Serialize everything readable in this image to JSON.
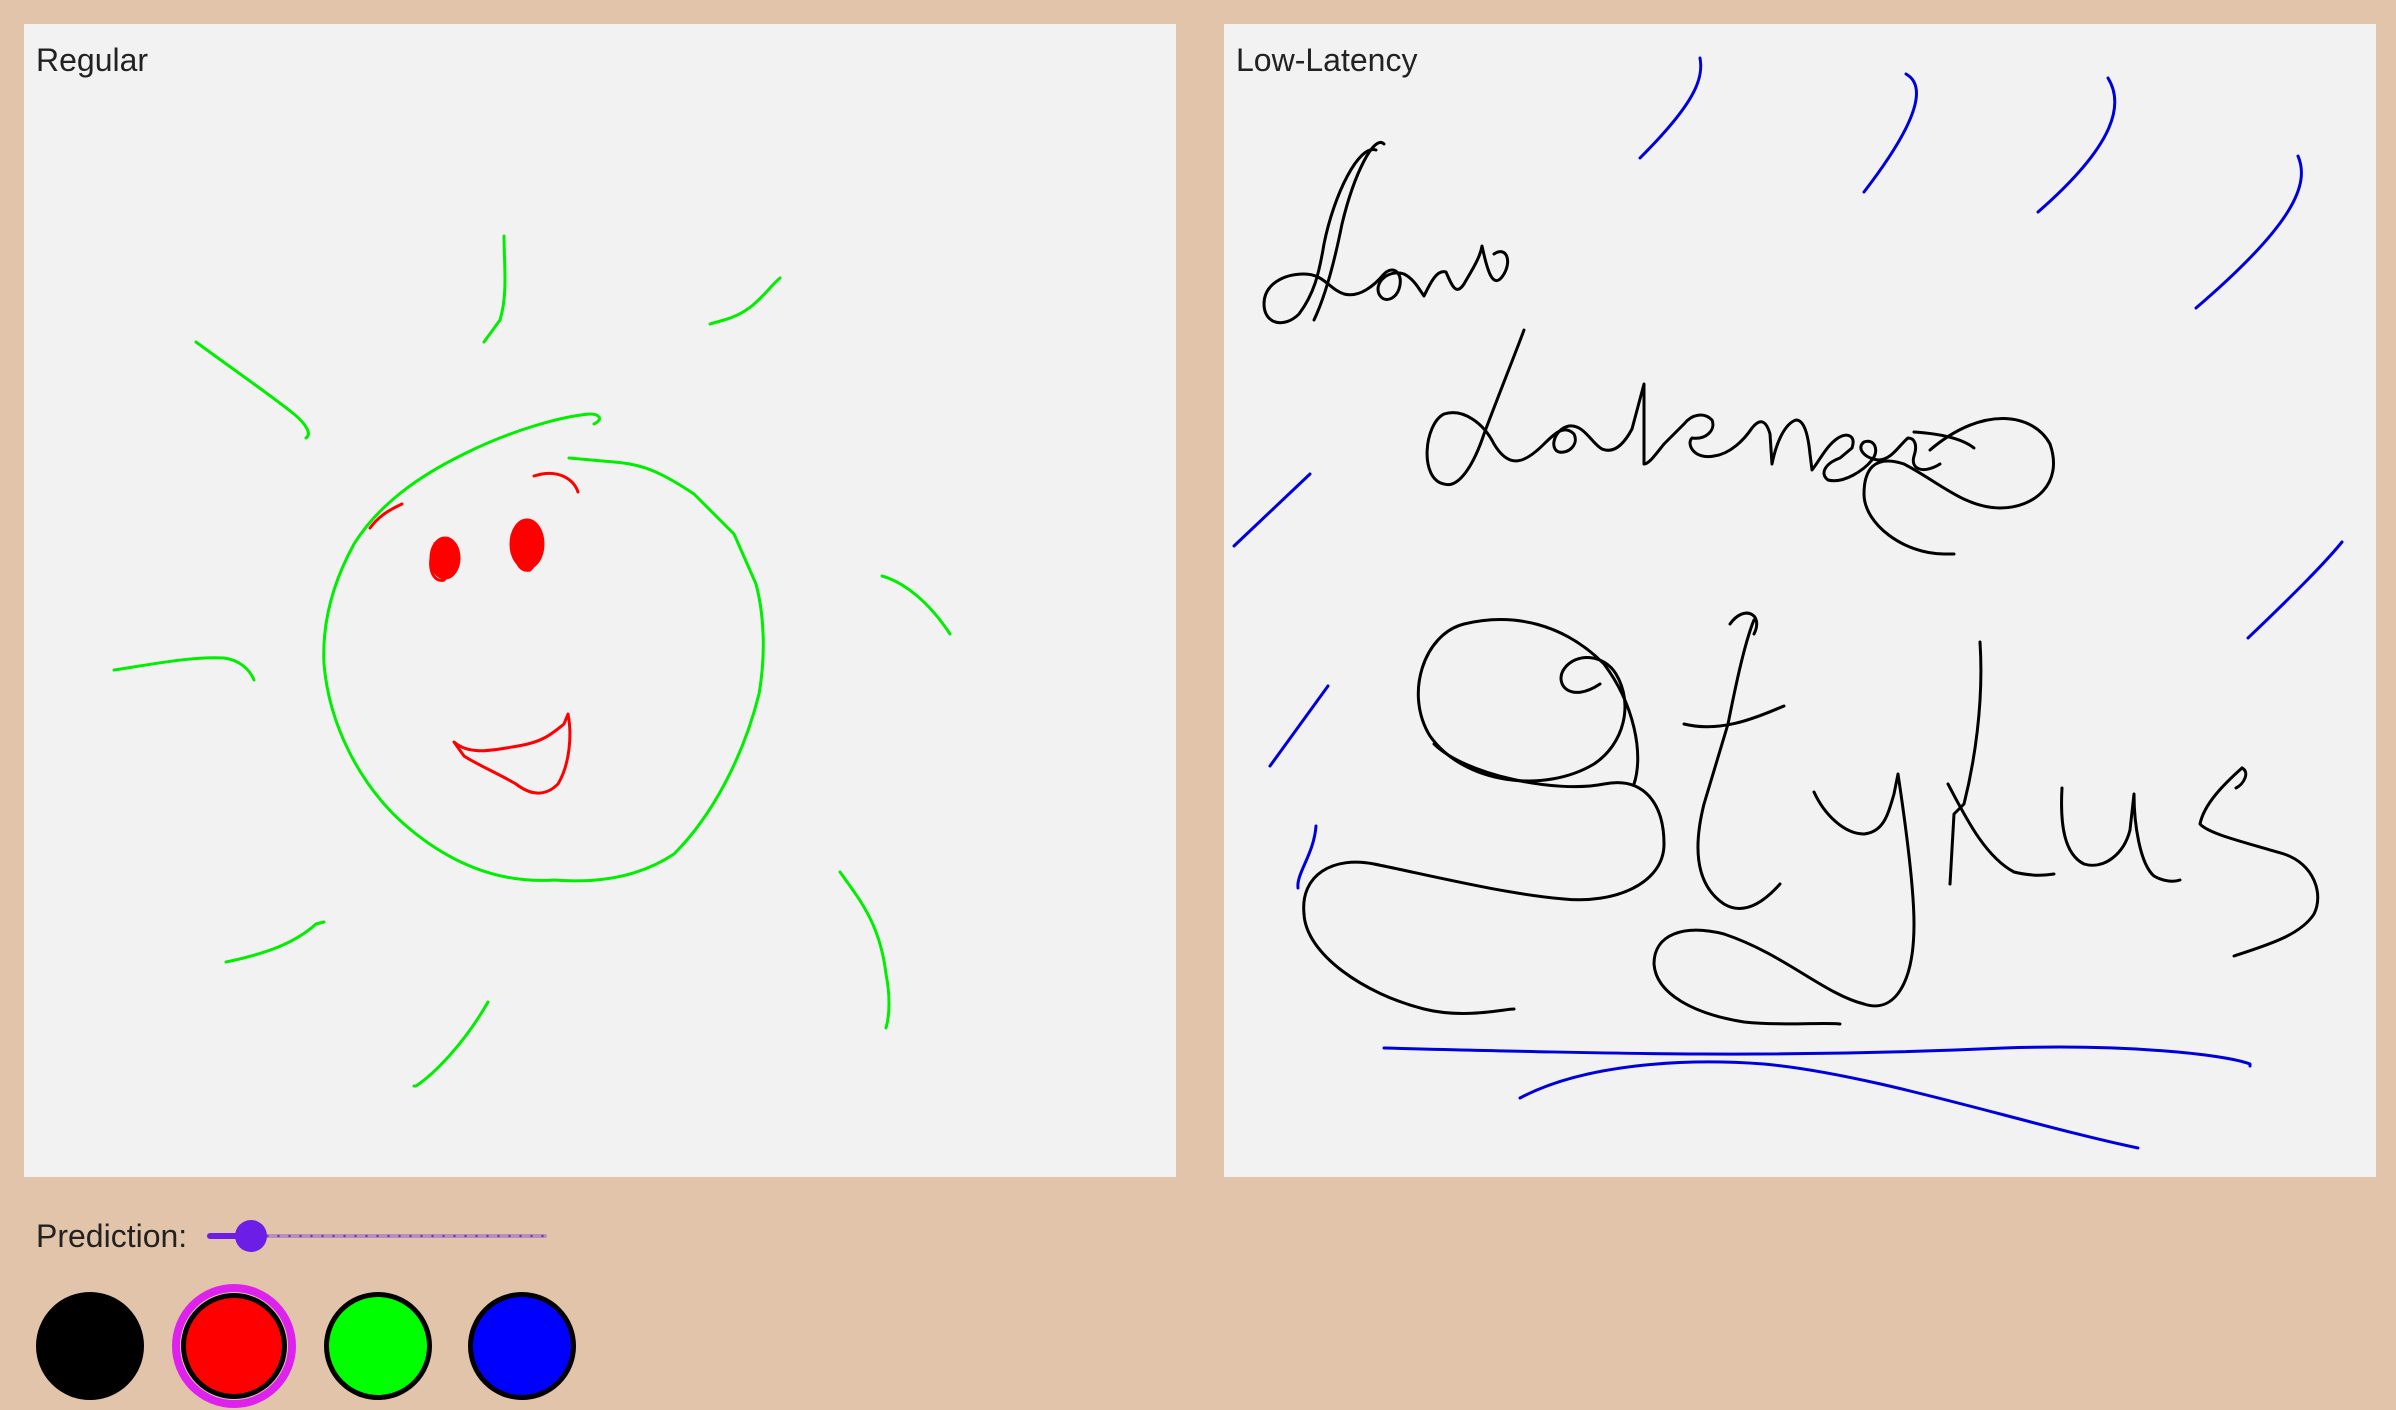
{
  "panels": {
    "regular": {
      "label": "Regular"
    },
    "low_latency": {
      "label": "Low-Latency"
    }
  },
  "prediction": {
    "label": "Prediction:",
    "value": 0.13,
    "accent_color": "#6c1ee6"
  },
  "colors": {
    "swatches": [
      {
        "name": "black",
        "hex": "#000000",
        "selected": false
      },
      {
        "name": "red",
        "hex": "#ff0000",
        "selected": true
      },
      {
        "name": "green",
        "hex": "#00ff00",
        "selected": false
      },
      {
        "name": "blue",
        "hex": "#0000ff",
        "selected": false
      }
    ],
    "selection_ring": "#dd22ee"
  },
  "drawing": {
    "regular": "smiling sun: green face and rays, red eyes and smile",
    "low_latency_text": [
      "Low",
      "Latency",
      "Stylus"
    ],
    "stroke_colors": {
      "text": "#000000",
      "decoration": "#0000ff",
      "sun": "#00ff00",
      "face": "#ff0000"
    }
  }
}
